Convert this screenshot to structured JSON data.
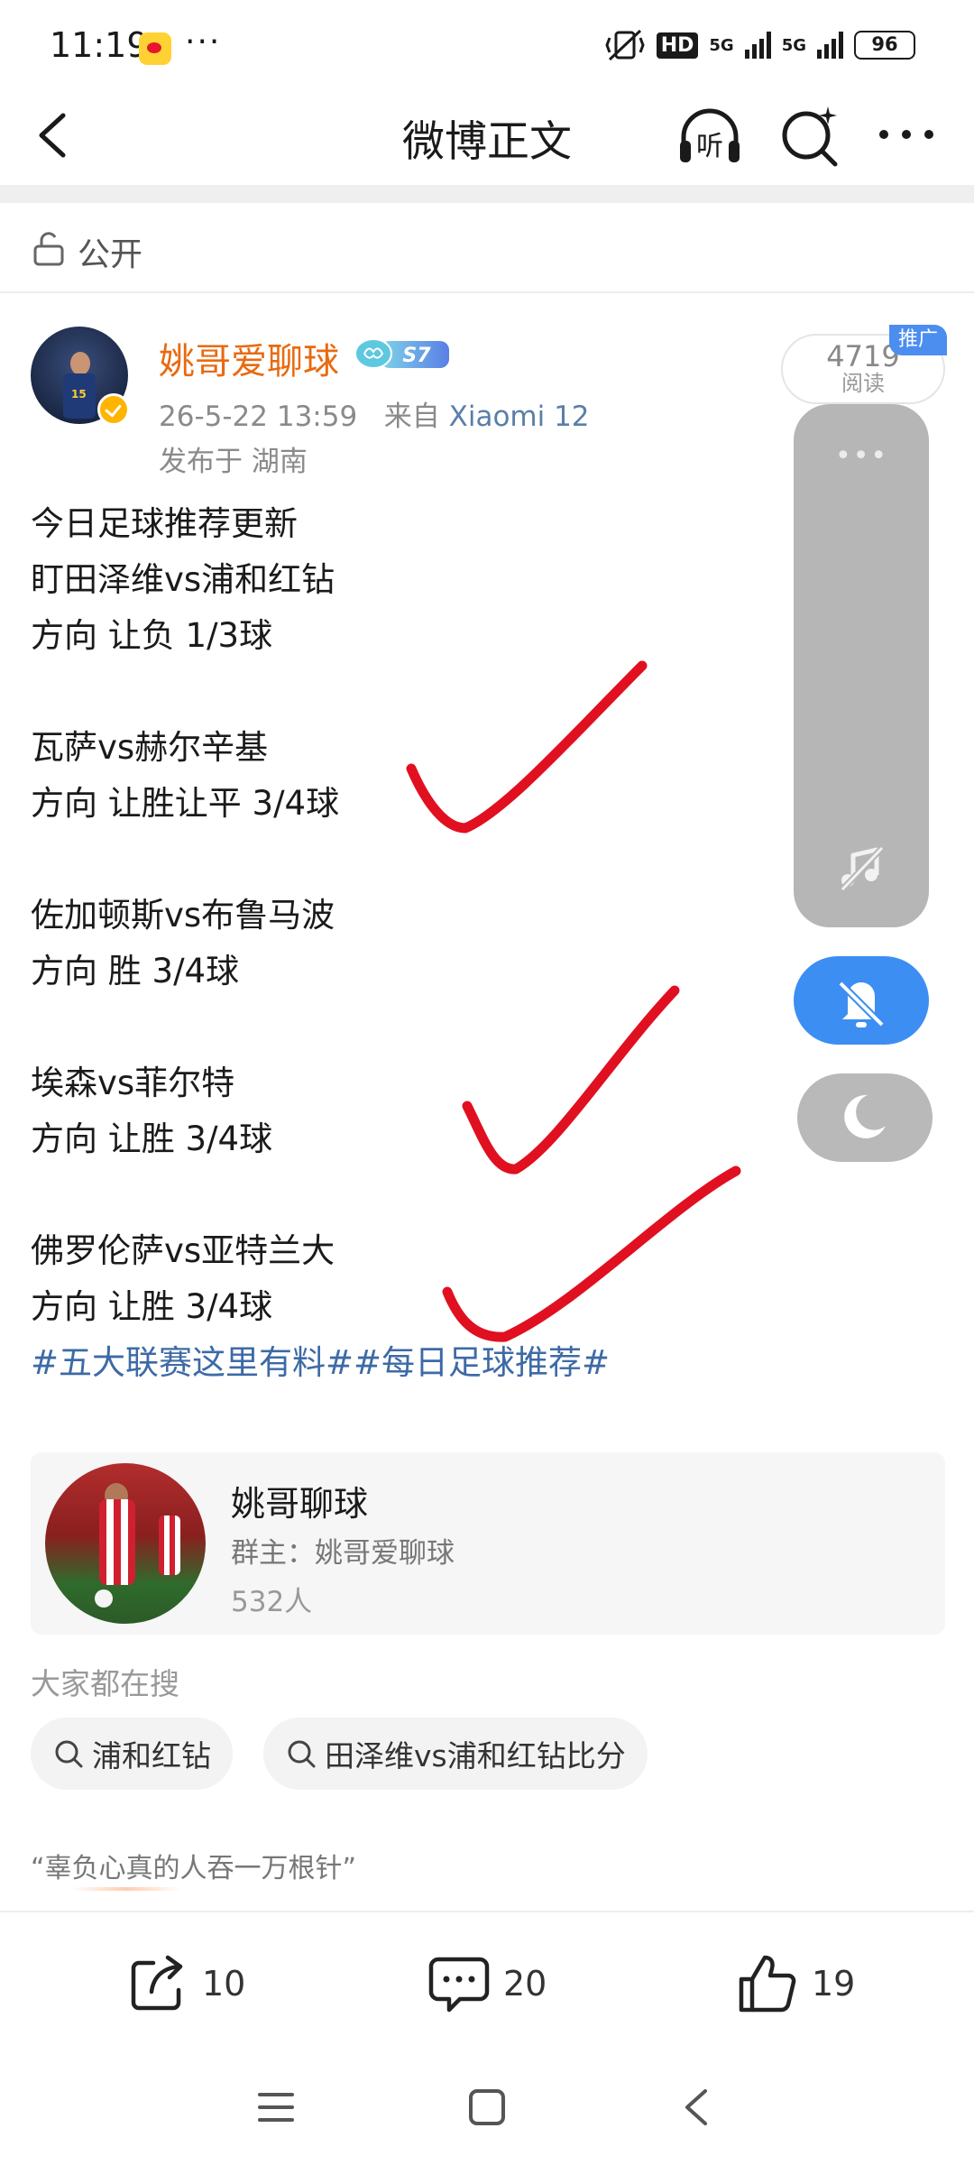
{
  "status_bar": {
    "time": "11:19",
    "dots": "···",
    "hd_label": "HD",
    "network_1": "5G",
    "network_2": "5G",
    "battery": "96"
  },
  "nav": {
    "title": "微博正文",
    "listen_label": "听"
  },
  "visibility": {
    "label": "公开"
  },
  "author": {
    "name": "姚哥爱聊球",
    "level": "S7",
    "date": "26-5-22 13:59",
    "source_prefix": "来自",
    "device": "Xiaomi 12",
    "location": "发布于 湖南"
  },
  "views": {
    "count": "4719",
    "label": "阅读",
    "ad_tag": "推广"
  },
  "post": {
    "lines": [
      "今日足球推荐更新",
      "盯田泽维vs浦和红钻",
      "方向 让负 1/3球",
      "",
      "瓦萨vs赫尔辛基",
      "方向 让胜让平 3/4球",
      "",
      "佐加顿斯vs布鲁马波",
      "方向 胜 3/4球",
      "",
      "埃森vs菲尔特",
      "方向 让胜 3/4球",
      "",
      "佛罗伦萨vs亚特兰大",
      "方向 让胜 3/4球"
    ],
    "hashtags": "#五大联赛这里有料##每日足球推荐#"
  },
  "group": {
    "name": "姚哥聊球",
    "owner": "群主：姚哥爱聊球",
    "members": "532人"
  },
  "searches": {
    "title": "大家都在搜",
    "items": [
      "浦和红钻",
      "田泽维vs浦和红钻比分"
    ]
  },
  "quote": "“辜负心真的人吞一万根针”",
  "actions": {
    "share_count": "10",
    "comment_count": "20",
    "like_count": "19"
  },
  "colors": {
    "author_name": "#e86a10",
    "hashtag": "#3d6aa6",
    "checkmark": "#e01020",
    "mute_button": "#3c8ef2",
    "ad_tag": "#4b8ef0"
  },
  "icons": [
    "back-icon",
    "headphone-icon",
    "ai-search-icon",
    "more-icon",
    "lock-icon",
    "music-off-icon",
    "bell-off-icon",
    "moon-icon",
    "search-icon",
    "share-icon",
    "comment-icon",
    "like-icon",
    "menu-icon",
    "home-icon",
    "nav-back-icon"
  ]
}
